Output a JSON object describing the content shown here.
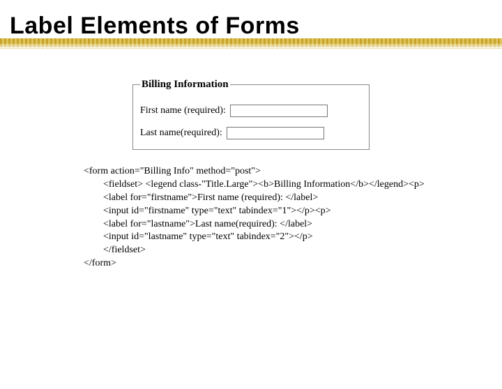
{
  "title": "Label Elements of Forms",
  "form": {
    "legend": "Billing Information",
    "rows": [
      {
        "label": "First name (required):"
      },
      {
        "label": "Last name(required):"
      }
    ]
  },
  "code": {
    "l1": "<form action=\"Billing Info\" method=\"post\">",
    "l2": "        <fieldset> <legend class-\"Title.Large\"><b>Billing Information</b></legend><p>",
    "l3": "        <label for=\"firstname\">First name (required): </label>",
    "l4": "        <input id=\"firstname\" type=\"text\" tabindex=\"1\"></p><p>",
    "l5": "        <label for=\"lastname\">Last name(required): </label>",
    "l6": "        <input id=\"lastname\" type=\"text\" tabindex=\"2\"></p>",
    "l7": "        </fieldset>",
    "l8": "</form>"
  }
}
